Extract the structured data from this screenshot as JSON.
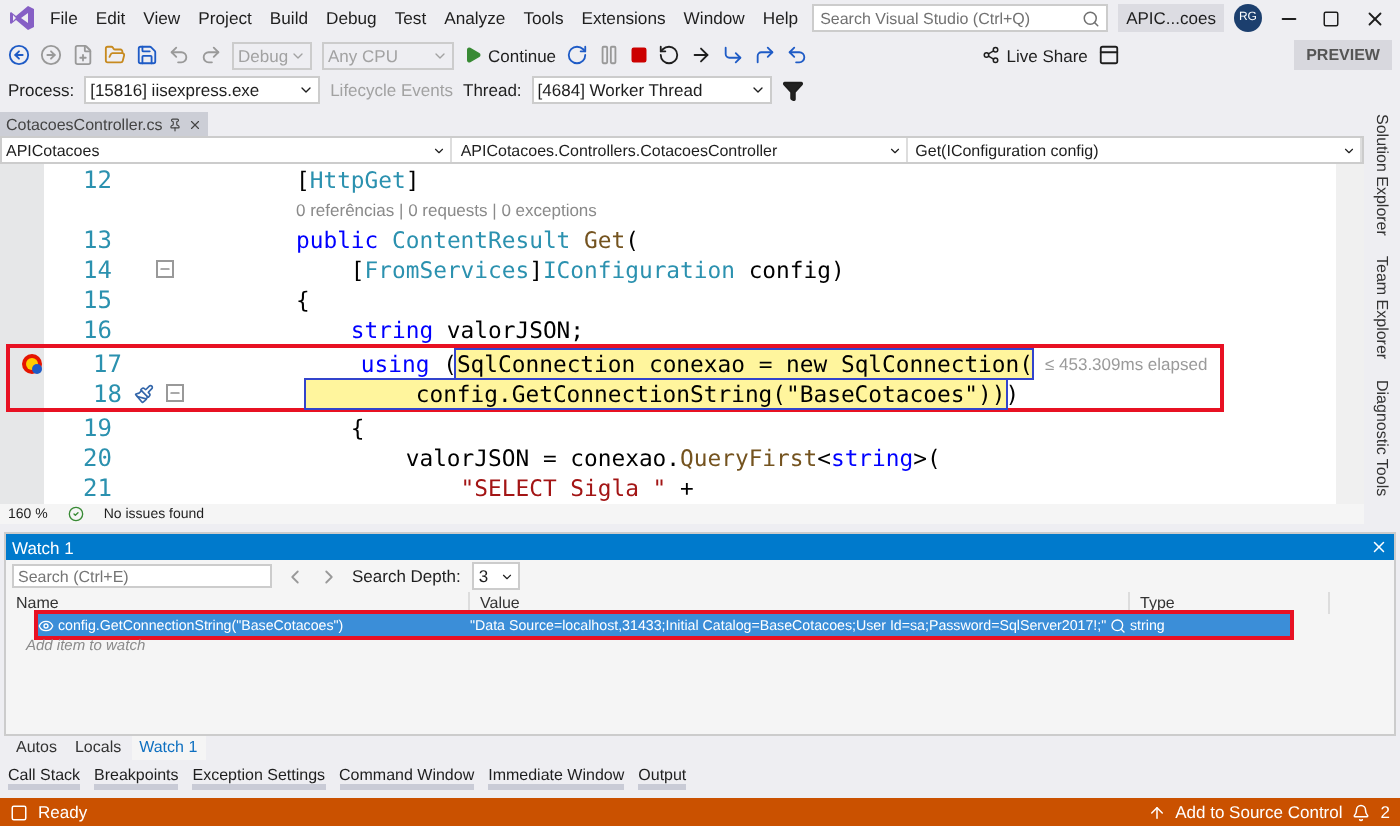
{
  "window": {
    "title": "APIC...coes",
    "user_initials": "RG",
    "preview_label": "PREVIEW"
  },
  "menu": [
    "File",
    "Edit",
    "View",
    "Project",
    "Build",
    "Debug",
    "Test",
    "Analyze",
    "Tools",
    "Extensions",
    "Window",
    "Help"
  ],
  "search": {
    "placeholder": "Search Visual Studio (Ctrl+Q)"
  },
  "toolbar": {
    "configuration": "Debug",
    "platform": "Any CPU",
    "continue_label": "Continue",
    "live_share": "Live Share"
  },
  "debug_location": {
    "process_label": "Process:",
    "process": "[15816] iisexpress.exe",
    "lifecycle": "Lifecycle Events",
    "thread_label": "Thread:",
    "thread": "[4684] Worker Thread"
  },
  "document_tabs": [
    {
      "label": "CotacoesController.cs",
      "selected": true
    }
  ],
  "navigation": [
    "APICotacoes",
    "APICotacoes.Controllers.CotacoesController",
    "Get(IConfiguration config)"
  ],
  "editor": {
    "lines": [
      {
        "kind": "code",
        "number": "12",
        "collapsible": false,
        "framed": false,
        "breakpoint": false,
        "quick_actions": false,
        "tokens": [
          {
            "text": "[",
            "kind": "plain",
            "current": false
          },
          {
            "text": "HttpGet",
            "kind": "type",
            "current": false
          },
          {
            "text": "]",
            "kind": "plain",
            "current": false
          }
        ]
      },
      {
        "kind": "codelens",
        "text": "0 referências | 0 requests | 0 exceptions"
      },
      {
        "kind": "code",
        "number": "13",
        "collapsible": false,
        "framed": false,
        "breakpoint": false,
        "quick_actions": false,
        "tokens": [
          {
            "text": "public",
            "kind": "keyword",
            "current": false
          },
          {
            "text": " ContentResult",
            "kind": "type",
            "current": false
          },
          {
            "text": " Get",
            "kind": "method",
            "current": false
          },
          {
            "text": "(",
            "kind": "plain",
            "current": false
          }
        ]
      },
      {
        "kind": "code",
        "number": "14",
        "collapsible": true,
        "framed": false,
        "breakpoint": false,
        "quick_actions": false,
        "tokens": [
          {
            "text": "    [",
            "kind": "plain",
            "current": false
          },
          {
            "text": "FromServices",
            "kind": "type",
            "current": false
          },
          {
            "text": "]",
            "kind": "plain",
            "current": false
          },
          {
            "text": "IConfiguration",
            "kind": "type",
            "current": false
          },
          {
            "text": " config)",
            "kind": "plain",
            "current": false
          }
        ]
      },
      {
        "kind": "code",
        "number": "15",
        "collapsible": false,
        "framed": false,
        "breakpoint": false,
        "quick_actions": false,
        "tokens": [
          {
            "text": "{",
            "kind": "plain",
            "current": false
          }
        ]
      },
      {
        "kind": "code",
        "number": "16",
        "collapsible": false,
        "framed": false,
        "breakpoint": false,
        "quick_actions": false,
        "tokens": [
          {
            "text": "    string",
            "kind": "keyword",
            "current": false
          },
          {
            "text": " valorJSON;",
            "kind": "plain",
            "current": false
          }
        ]
      },
      {
        "kind": "code",
        "number": "17",
        "collapsible": false,
        "framed": true,
        "breakpoint": true,
        "quick_actions": false,
        "hint": "≤ 453.309ms elapsed",
        "tokens": [
          {
            "text": "    using",
            "kind": "keyword",
            "current": false
          },
          {
            "text": " (",
            "kind": "plain",
            "current": false
          },
          {
            "text": "SqlConnection conexao = new SqlConnection(",
            "kind": "plain",
            "current": true
          }
        ]
      },
      {
        "kind": "code",
        "number": "18",
        "collapsible": true,
        "framed": true,
        "breakpoint": false,
        "quick_actions": true,
        "tokens": [
          {
            "text": "        config.GetConnectionString(\"BaseCotacoes\"))",
            "kind": "plain",
            "current": true
          },
          {
            "text": ")",
            "kind": "plain",
            "current": false
          }
        ]
      },
      {
        "kind": "code",
        "number": "19",
        "collapsible": false,
        "framed": false,
        "breakpoint": false,
        "quick_actions": false,
        "tokens": [
          {
            "text": "    {",
            "kind": "plain",
            "current": false
          }
        ]
      },
      {
        "kind": "code",
        "number": "20",
        "collapsible": false,
        "framed": false,
        "breakpoint": false,
        "quick_actions": false,
        "tokens": [
          {
            "text": "        valorJSON = conexao.",
            "kind": "plain",
            "current": false
          },
          {
            "text": "QueryFirst",
            "kind": "method",
            "current": false
          },
          {
            "text": "<",
            "kind": "plain",
            "current": false
          },
          {
            "text": "string",
            "kind": "keyword",
            "current": false
          },
          {
            "text": ">(",
            "kind": "plain",
            "current": false
          }
        ]
      },
      {
        "kind": "code",
        "number": "21",
        "collapsible": false,
        "framed": false,
        "breakpoint": false,
        "quick_actions": false,
        "tokens": [
          {
            "text": "            \"SELECT Sigla \"",
            "kind": "string",
            "current": false
          },
          {
            "text": " +",
            "kind": "plain",
            "current": false
          }
        ]
      }
    ],
    "zoom": "160 %",
    "issues": "No issues found"
  },
  "side_tabs": [
    "Solution Explorer",
    "Team Explorer",
    "Diagnostic Tools"
  ],
  "watch": {
    "title": "Watch 1",
    "search_placeholder": "Search (Ctrl+E)",
    "depth_label": "Search Depth:",
    "depth": "3",
    "columns": [
      "Name",
      "Value",
      "Type"
    ],
    "rows": [
      {
        "name": "config.GetConnectionString(\"BaseCotacoes\")",
        "value": "\"Data Source=localhost,31433;Initial Catalog=BaseCotacoes;User Id=sa;Password=SqlServer2017!;\"",
        "type": "string",
        "selected": true
      }
    ],
    "add_placeholder": "Add item to watch"
  },
  "debug_tabs": [
    {
      "label": "Autos",
      "selected": false
    },
    {
      "label": "Locals",
      "selected": false
    },
    {
      "label": "Watch 1",
      "selected": true
    }
  ],
  "tool_tabs": [
    "Call Stack",
    "Breakpoints",
    "Exception Settings",
    "Command Window",
    "Immediate Window",
    "Output"
  ],
  "status_bar": {
    "state": "Ready",
    "source_control": "Add to Source Control",
    "notifications": "2"
  }
}
